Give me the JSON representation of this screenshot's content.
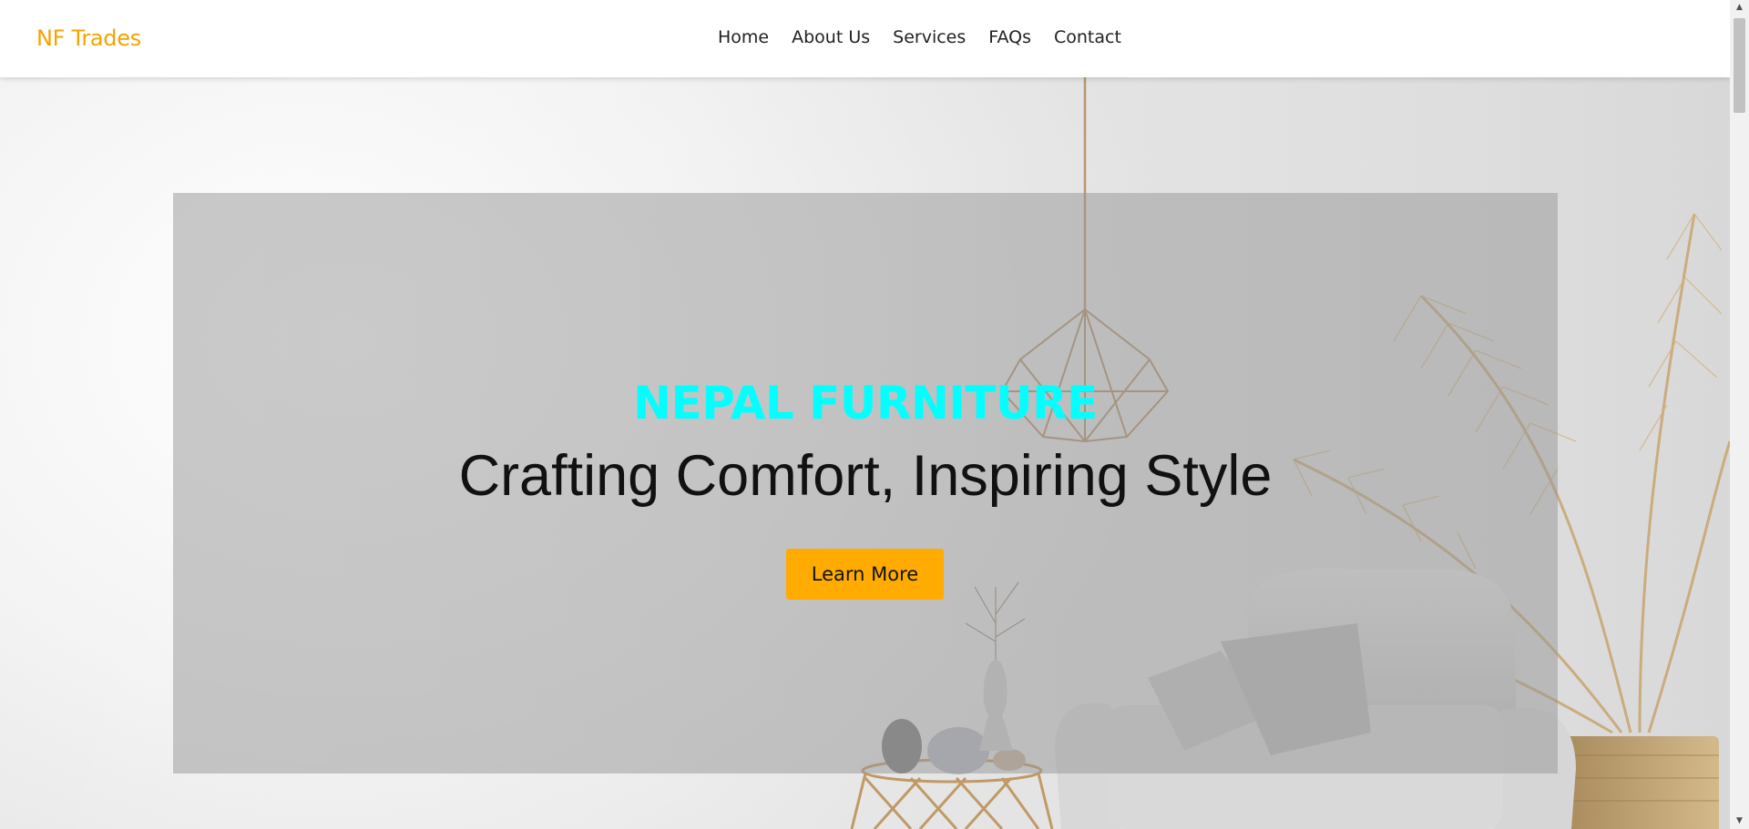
{
  "header": {
    "brand": "NF Trades",
    "nav": [
      {
        "label": "Home"
      },
      {
        "label": "About Us"
      },
      {
        "label": "Services"
      },
      {
        "label": "FAQs"
      },
      {
        "label": "Contact"
      }
    ]
  },
  "hero": {
    "subtitle": "NEPAL FURNITURE",
    "title": "Crafting Comfort, Inspiring Style",
    "cta_label": "Learn More"
  },
  "scrollbar": {
    "up_icon": "▲",
    "down_icon": "▼"
  },
  "colors": {
    "brand": "#f5a300",
    "subtitle": "#00ffff",
    "cta": "#ffab00",
    "overlay": "rgba(150,150,150,0.5)"
  },
  "icons": [
    "triangle-up-icon",
    "triangle-down-icon"
  ]
}
